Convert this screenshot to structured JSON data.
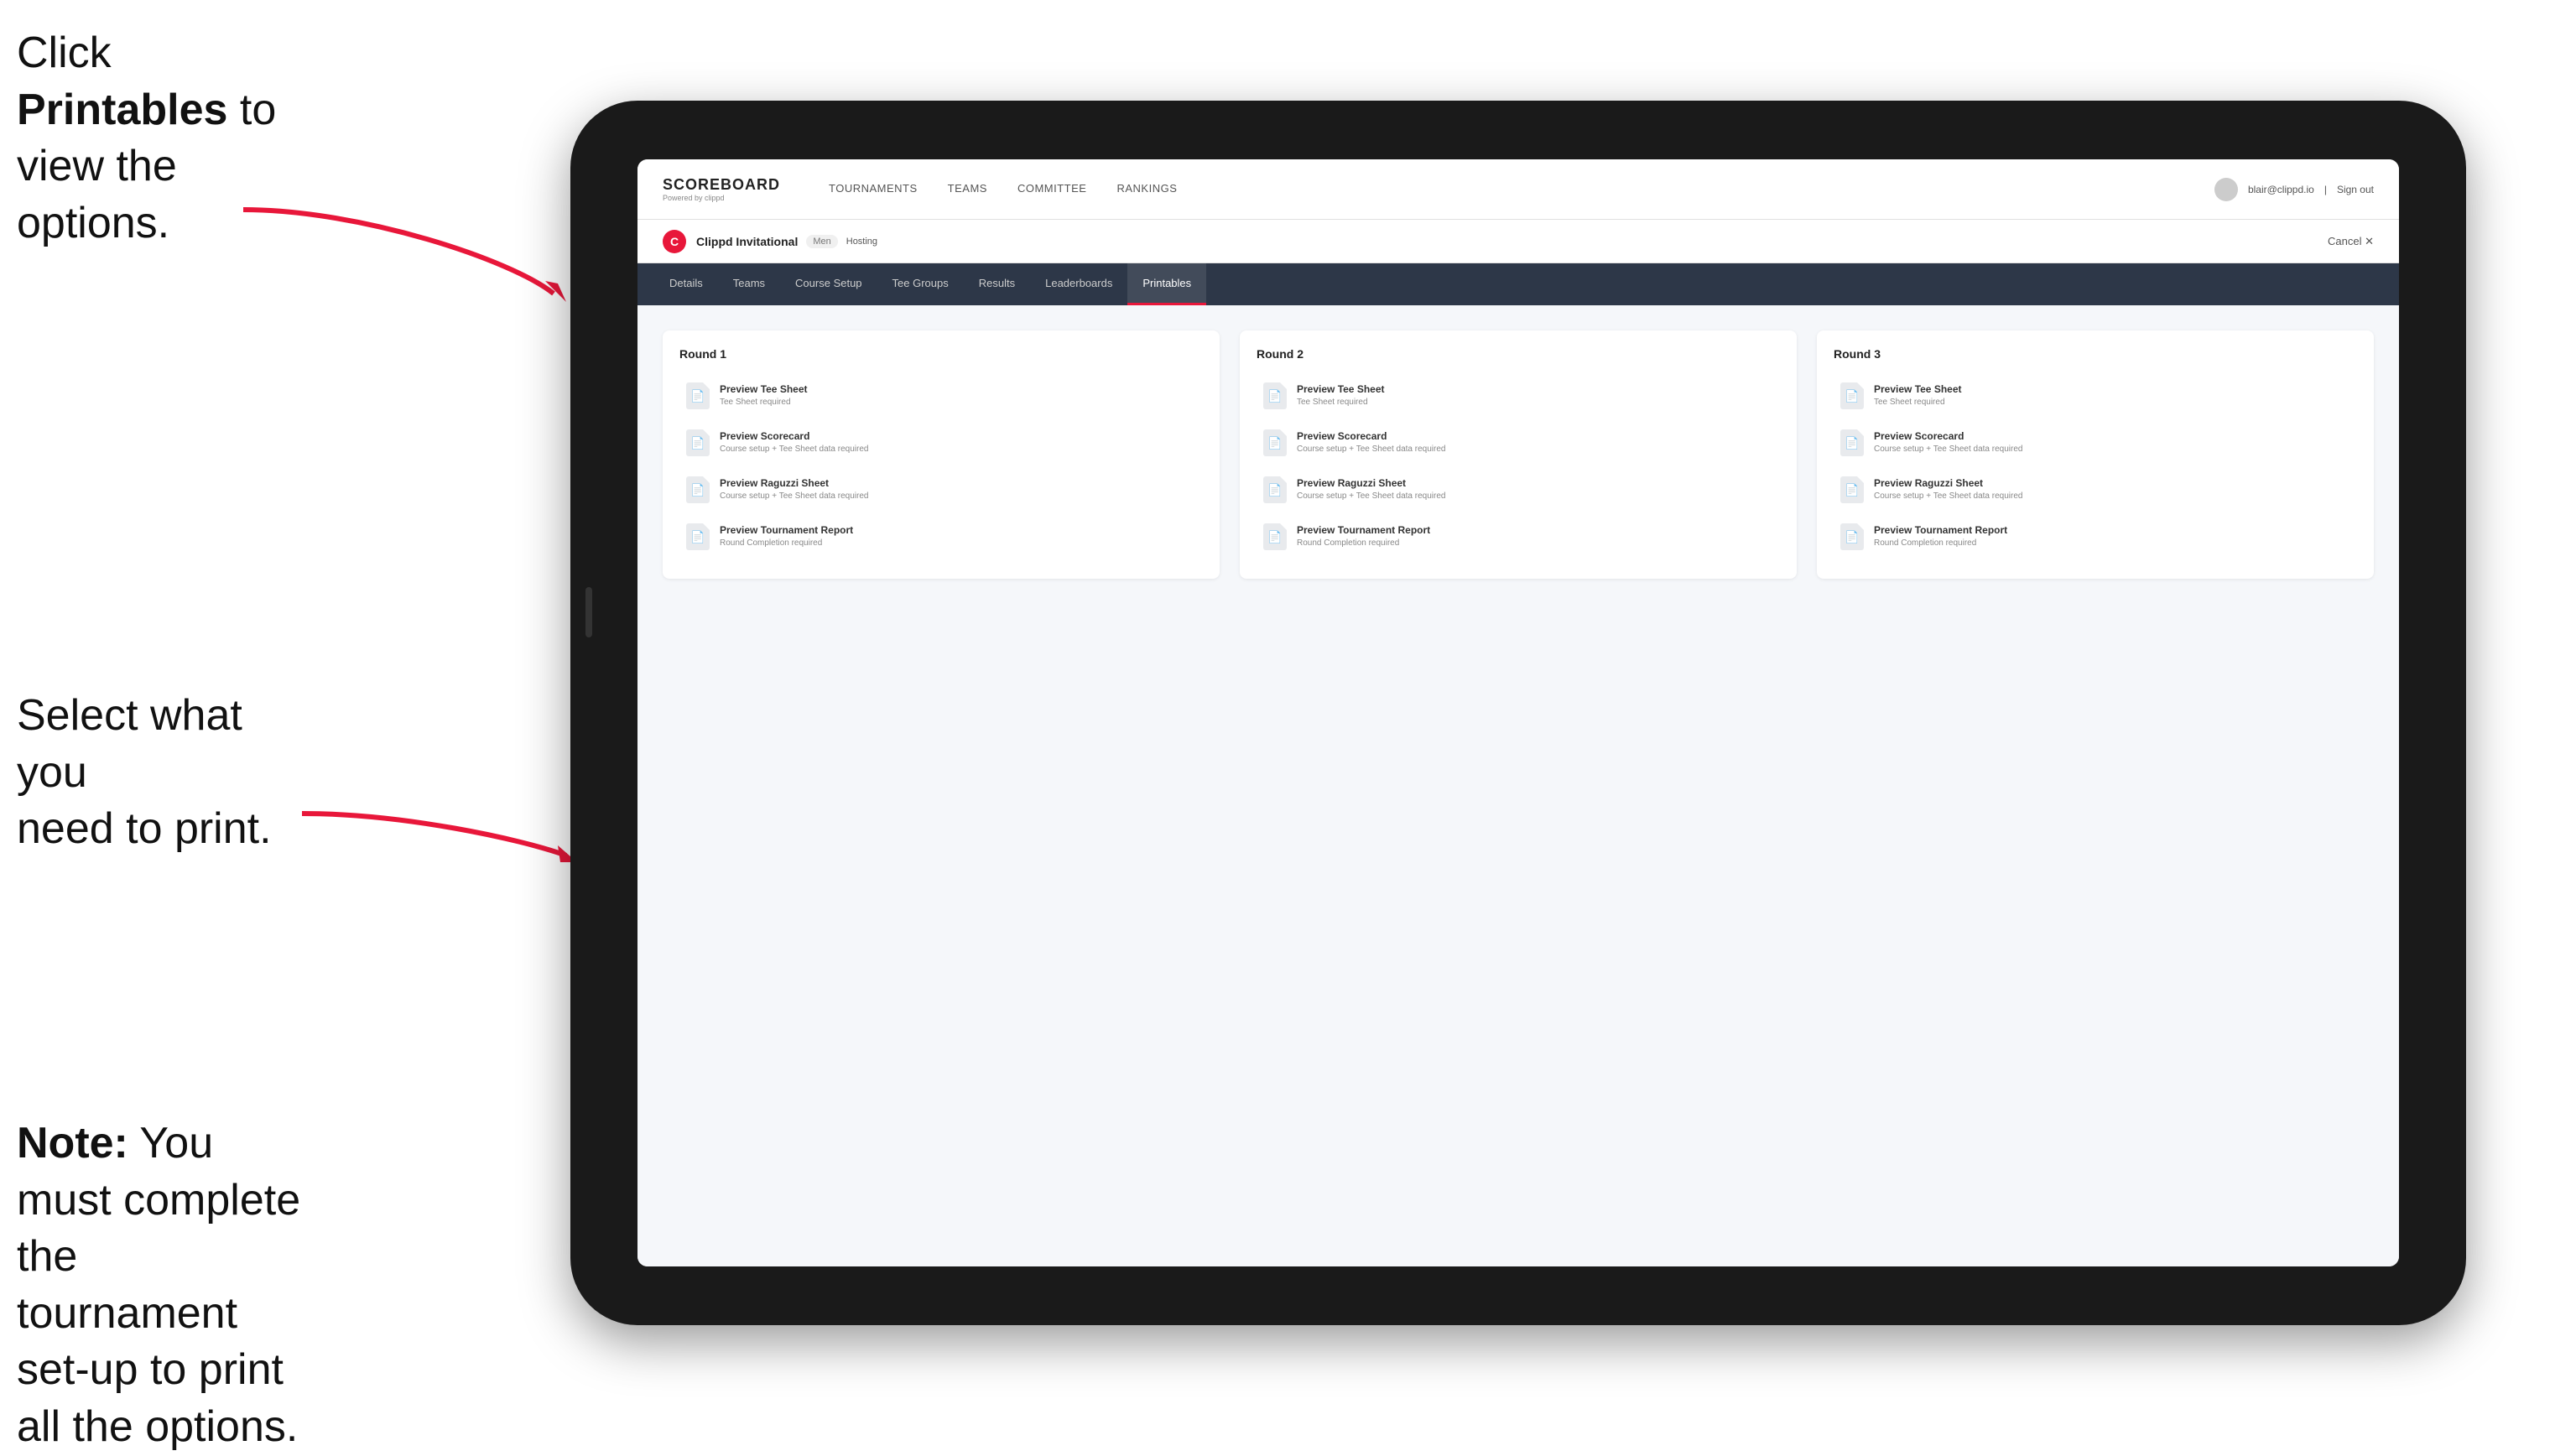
{
  "instructions": {
    "top": {
      "line1": "Click ",
      "bold": "Printables",
      "line2": " to",
      "line3": "view the options."
    },
    "middle": {
      "line1": "Select what you",
      "line2": "need to print."
    },
    "bottom": {
      "bold_prefix": "Note:",
      "text": " You must complete the tournament set-up to print all the options."
    }
  },
  "nav": {
    "logo": "SCOREBOARD",
    "logo_sub": "Powered by clippd",
    "links": [
      {
        "label": "TOURNAMENTS",
        "active": false
      },
      {
        "label": "TEAMS",
        "active": false
      },
      {
        "label": "COMMITTEE",
        "active": false
      },
      {
        "label": "RANKINGS",
        "active": false
      }
    ],
    "user_email": "blair@clippd.io",
    "sign_out": "Sign out"
  },
  "tournament": {
    "initial": "C",
    "name": "Clippd Invitational",
    "badge": "Men",
    "status": "Hosting",
    "cancel": "Cancel ✕"
  },
  "tabs": [
    {
      "label": "Details",
      "active": false
    },
    {
      "label": "Teams",
      "active": false
    },
    {
      "label": "Course Setup",
      "active": false
    },
    {
      "label": "Tee Groups",
      "active": false
    },
    {
      "label": "Results",
      "active": false
    },
    {
      "label": "Leaderboards",
      "active": false
    },
    {
      "label": "Printables",
      "active": true
    }
  ],
  "rounds": [
    {
      "title": "Round 1",
      "items": [
        {
          "title": "Preview Tee Sheet",
          "subtitle": "Tee Sheet required"
        },
        {
          "title": "Preview Scorecard",
          "subtitle": "Course setup + Tee Sheet data required"
        },
        {
          "title": "Preview Raguzzi Sheet",
          "subtitle": "Course setup + Tee Sheet data required"
        },
        {
          "title": "Preview Tournament Report",
          "subtitle": "Round Completion required"
        }
      ]
    },
    {
      "title": "Round 2",
      "items": [
        {
          "title": "Preview Tee Sheet",
          "subtitle": "Tee Sheet required"
        },
        {
          "title": "Preview Scorecard",
          "subtitle": "Course setup + Tee Sheet data required"
        },
        {
          "title": "Preview Raguzzi Sheet",
          "subtitle": "Course setup + Tee Sheet data required"
        },
        {
          "title": "Preview Tournament Report",
          "subtitle": "Round Completion required"
        }
      ]
    },
    {
      "title": "Round 3",
      "items": [
        {
          "title": "Preview Tee Sheet",
          "subtitle": "Tee Sheet required"
        },
        {
          "title": "Preview Scorecard",
          "subtitle": "Course setup + Tee Sheet data required"
        },
        {
          "title": "Preview Raguzzi Sheet",
          "subtitle": "Course setup + Tee Sheet data required"
        },
        {
          "title": "Preview Tournament Report",
          "subtitle": "Round Completion required"
        }
      ]
    }
  ]
}
